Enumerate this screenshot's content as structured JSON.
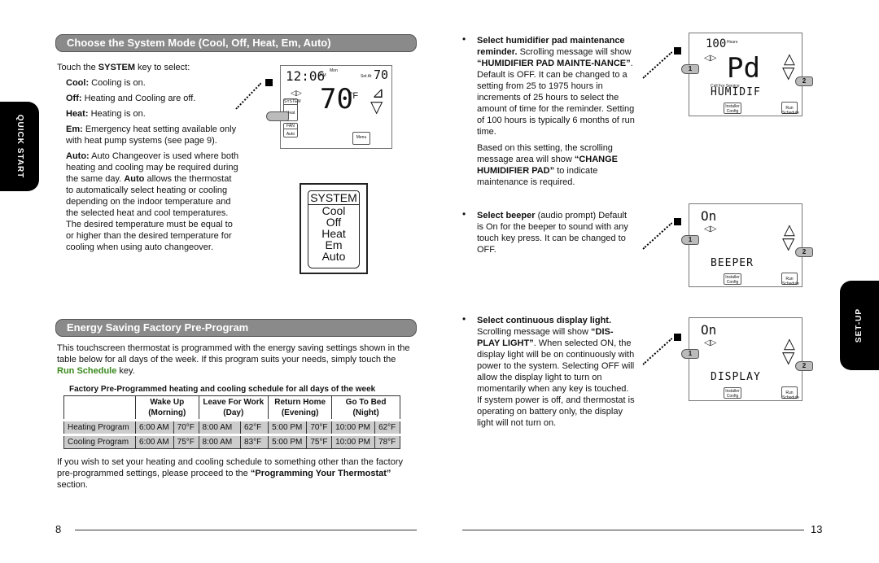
{
  "left": {
    "section1_title": "Choose the System Mode (Cool, Off, Heat, Em, Auto)",
    "intro_pre": "Touch the ",
    "intro_key": "SYSTEM",
    "intro_post": " key to select:",
    "modes": [
      {
        "label": "Cool:",
        "text": " Cooling is on."
      },
      {
        "label": "Off:",
        "text": " Heating and Cooling are off."
      },
      {
        "label": "Heat:",
        "text": " Heating is on."
      },
      {
        "label": "Em:",
        "text": " Emergency heat setting available only with heat pump systems (see page 9)."
      },
      {
        "label": "Auto:",
        "text": " Auto Changeover is used where both heating and cooling may be required during the same day. ",
        "label2": "Auto",
        "text2": " allows the thermostat to automatically select heating or cooling depending on the indoor temperature and the selected heat and cool temperatures. The desired temperature must be equal to or higher than the desired temperature for cooling when using auto changeover."
      }
    ],
    "thermostat": {
      "time": "12:06",
      "ampm": "PM",
      "day": "Mon",
      "set_at_label": "Set At",
      "set_at": "70",
      "temp": "70",
      "unit": "°F",
      "system_label": "SYSTEM",
      "system_value": "Heat",
      "fan_label": "FAN",
      "fan_value": "Auto",
      "menu": "Menu"
    },
    "system_key": {
      "title": "SYSTEM",
      "options": [
        "Cool",
        "Off",
        "Heat",
        "Em",
        "Auto"
      ]
    },
    "section2_title": "Energy Saving Factory Pre-Program",
    "para1_pre": "This touchscreen thermostat is programmed with the energy saving settings shown in the table below for all days of the week. If this program suits your needs, simply touch the ",
    "para1_key": "Run Schedule",
    "para1_post": " key.",
    "table_caption": "Factory Pre-Programmed heating and cooling schedule for all days of the week",
    "table": {
      "headers": [
        [
          "Wake Up",
          "(Morning)"
        ],
        [
          "Leave For Work",
          "(Day)"
        ],
        [
          "Return Home",
          "(Evening)"
        ],
        [
          "Go To Bed",
          "(Night)"
        ]
      ],
      "rows": [
        {
          "label": "Heating Program",
          "cells": [
            "6:00 AM",
            "70°F",
            "8:00 AM",
            "62°F",
            "5:00 PM",
            "70°F",
            "10:00 PM",
            "62°F"
          ]
        },
        {
          "label": "Cooling Program",
          "cells": [
            "6:00 AM",
            "75°F",
            "8:00 AM",
            "83°F",
            "5:00 PM",
            "75°F",
            "10:00 PM",
            "78°F"
          ]
        }
      ]
    },
    "para2_pre": "If you wish to set your heating and cooling schedule to something other than the factory pre-programmed settings, please proceed to the ",
    "para2_bold": "“Programming Your Thermostat”",
    "para2_post": " section.",
    "tab": "QUICK START",
    "page_number": "8"
  },
  "right": {
    "items": [
      {
        "title": "Select humidifier pad maintenance reminder.",
        "text": " Scrolling message will show ",
        "bold": "“HUMIDIFIER PAD MAINTE-NANCE”",
        "text2": ". Default is OFF. It can be changed to a setting from 25 to 1975 hours in increments of 25 hours to select the amount of time for the reminder. Setting of 100 hours is typically 6 months of run time.",
        "extra_pre": "Based on this setting, the scrolling message area will show ",
        "extra_bold": "“CHANGE HUMIDIFIER PAD”",
        "extra_post": " to indicate maintenance is required.",
        "display": {
          "top": "100",
          "top_label": "Hours",
          "main": "Pd",
          "sub_label": "Call For Service",
          "message": "HUMIDIF"
        }
      },
      {
        "title": "Select beeper",
        "text": " (audio prompt) Default is On for the beeper to sound with any touch key press. It can be changed to OFF.",
        "display": {
          "top": "On",
          "main": "",
          "message": "BEEPER"
        }
      },
      {
        "title": "Select continuous display light.",
        "text": " Scrolling message will show ",
        "bold": "“DIS-PLAY LIGHT”",
        "text2": ". When selected ON, the display light will be on continuously with power to the system. Selecting OFF will allow the display light to turn on momentarily when any key is touched. If system power is off, and thermostat is operating on battery only, the display light will not turn on.",
        "display": {
          "top": "On",
          "main": "",
          "message": "DISPLAY"
        }
      }
    ],
    "display_keys": {
      "installer": "Installer Config",
      "run": "Run Schedule",
      "step1": "1",
      "step2": "2"
    },
    "tab": "SET-UP",
    "page_number": "13"
  }
}
